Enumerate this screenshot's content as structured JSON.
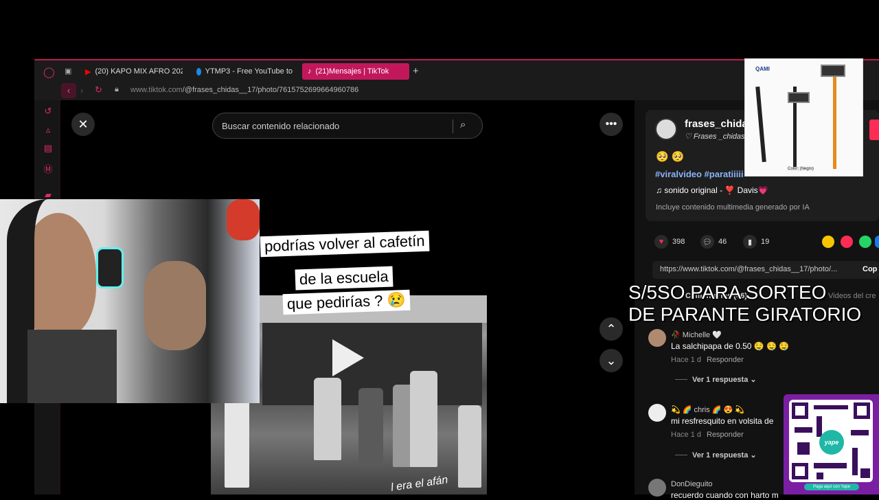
{
  "browser": {
    "tabs": [
      {
        "label": "(20) KAPO MIX AFRO 202"
      },
      {
        "label": "YTMP3 - Free YouTube to"
      },
      {
        "label": "(21)Mensajes | TikTok"
      }
    ],
    "url_host": "www.tiktok.com",
    "url_path": "/@frases_chidas__17/photo/7615752699664960786"
  },
  "viewer": {
    "search_placeholder": "Buscar contenido relacionado",
    "caption_lines": [
      "podrías volver al cafetín",
      "de la escuela",
      "que pedirías ? 😢"
    ],
    "photo_footer": "l era el afán"
  },
  "post": {
    "username": "frases_chida",
    "display_name": "♡ Frases _chidas",
    "emojis": "🥺 🥺",
    "hashtags": "#viralvideo #paratiiiii",
    "sound": "sonido original - ❣️ Davis💗",
    "ai_notice": "Incluye contenido multimedia generado por IA",
    "likes": "398",
    "comments": "46",
    "saves": "19",
    "share_url": "https://www.tiktok.com/@frases_chidas__17/photo/...",
    "copy_label": "Cop",
    "comments_tab": "Comentarios (46)",
    "creator_tab": "Videos del cre"
  },
  "comments": [
    {
      "author": "🥀 Michelle 🤍",
      "text": "La salchipapa de 0.50 🤤 🤤 🤤",
      "time": "Hace 1 d",
      "reply": "Responder",
      "more": "Ver 1 respuesta"
    },
    {
      "author": "💫 🌈 chris 🌈 😍 💫",
      "text": "mi resfresquito en volsita de",
      "time": "Hace 1 d",
      "reply": "Responder",
      "more": "Ver 1 respuesta"
    },
    {
      "author": "DonDieguito",
      "text": "recuerdo cuando con harto m"
    }
  ],
  "overlay": {
    "line1": "S/5SO PARA SORTEO",
    "line2": "DE PARANTE GIRATORIO"
  },
  "ad": {
    "brand": "QAMI",
    "color_label": "Color: (Negro)"
  },
  "qr": {
    "label": "Paga aquí con Yape",
    "brand": "yape"
  },
  "colors": {
    "accent": "#c2185b",
    "like": "#fe2c55",
    "link": "#8ab4f8"
  }
}
